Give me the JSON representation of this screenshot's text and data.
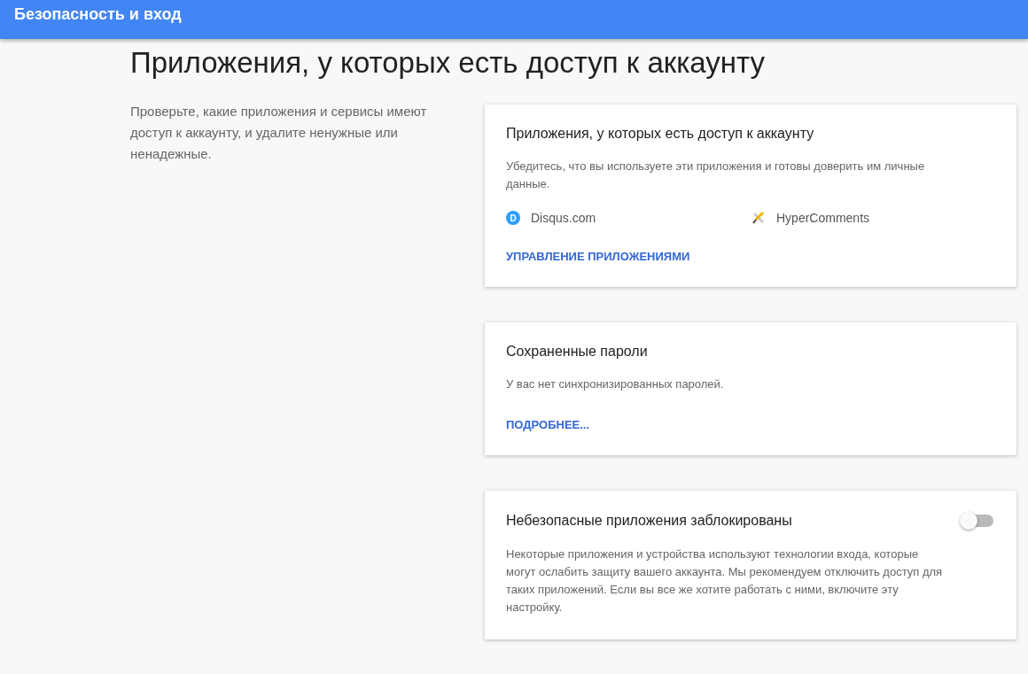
{
  "header": {
    "title": "Безопасность и вход"
  },
  "page_title": "Приложения, у которых есть доступ к аккаунту",
  "intro": "Проверьте, какие приложения и сервисы имеют доступ к аккаунту, и удалите ненужные или ненадежные.",
  "cards": [
    {
      "kind": "apps",
      "title": "Приложения, у которых есть доступ к аккаунту",
      "text": "Убедитесь, что вы используете эти приложения и готовы доверить им личные данные.",
      "apps": [
        {
          "kind": "disqus",
          "icon_letter": "D",
          "name": "Disqus.com"
        },
        {
          "kind": "hyper",
          "name": "HyperComments"
        }
      ],
      "link": "УПРАВЛЕНИЕ ПРИЛОЖЕНИЯМИ"
    },
    {
      "kind": "passwords",
      "title": "Сохраненные пароли",
      "text": "У вас нет синхронизированных паролей.",
      "link": "ПОДРОБНЕЕ..."
    },
    {
      "kind": "toggle",
      "title": "Небезопасные приложения заблокированы",
      "on": false,
      "text": "Некоторые приложения и устройства используют технологии входа, которые могут ослабить защиту вашего аккаунта. Мы рекомендуем отключить доступ для таких приложений. Если вы все же хотите работать с ними, включите эту настройку."
    }
  ]
}
